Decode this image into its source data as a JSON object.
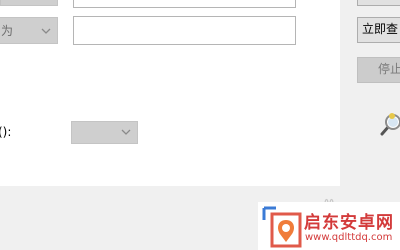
{
  "form": {
    "row2_combo_value": "为",
    "row3_label": "():",
    "row3_combo_value": ""
  },
  "buttons": {
    "query_now": "立即查",
    "stop": "停止"
  },
  "watermark": {
    "brand": "启东安卓网",
    "url": "www.qdlttdq.com"
  },
  "colors": {
    "watermark_red": "#d33a3a",
    "disabled_fill": "#cfcfcf"
  },
  "icons": [
    "chevron-down-icon",
    "search-icon",
    "brand-logo-icon"
  ]
}
